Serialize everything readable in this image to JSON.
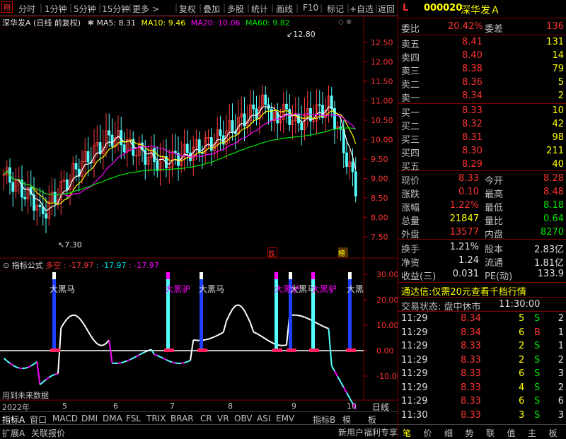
{
  "toolbar": {
    "items": [
      "分时",
      "1分钟",
      "5分钟",
      "15分钟",
      "更多 >",
      "复权",
      "叠加",
      "多股",
      "统计",
      "画线",
      "F10",
      "标记",
      "+自选",
      "返回"
    ]
  },
  "chart_header": {
    "name": "深华发A (日线 前复权)",
    "ma5_label": "MA5: 8.31",
    "ma10_label": "MA10: 9.46",
    "ma20_label": "MA20: 10.06",
    "ma60_label": "MA60: 9.82"
  },
  "price_axis": [
    "12.50",
    "12.00",
    "11.50",
    "11.00",
    "10.50",
    "10.00",
    "9.50",
    "9.00",
    "8.50",
    "8.00",
    "7.50"
  ],
  "annotations": {
    "high": "12.80",
    "low": "7.30",
    "limit_down": "跌",
    "list_tag": "榜"
  },
  "indicator_header": {
    "name": "指标公式",
    "label_kong": "多空",
    "v1": ": -17.97",
    "v2": ": -17.97",
    "v3": ": -17.97"
  },
  "indicator_axis": [
    "30.00",
    "20.00",
    "10.00",
    "0.00",
    "-10.00",
    "-20.00"
  ],
  "signals": [
    "大黑马",
    "大黑驴",
    "大黑马",
    "大黑驴",
    "大黑马",
    "大黑驴",
    "大黑"
  ],
  "future_note": "用到未来数据",
  "date_axis": [
    "2022年",
    "5",
    "6",
    "7",
    "8",
    "9",
    "10"
  ],
  "period_label": "日线",
  "bottom_tabs": [
    "指标A",
    "窗口",
    "MACD",
    "DMI",
    "DMA",
    "FSL",
    "TRIX",
    "BRAR",
    "CR",
    "VR",
    "OBV",
    "ASI",
    "EMV",
    "指标B",
    "模",
    "板"
  ],
  "bottom_row2": [
    "扩展A",
    "关联报价"
  ],
  "right_panel": {
    "header_l": "L",
    "code": "000020",
    "name": "深华发Ａ",
    "weibi": {
      "label": "委比",
      "value": "20.42%",
      "label2": "委差",
      "value2": "136"
    },
    "asks": [
      {
        "label": "卖五",
        "price": "8.41",
        "vol": "131"
      },
      {
        "label": "卖四",
        "price": "8.40",
        "vol": "14"
      },
      {
        "label": "卖三",
        "price": "8.38",
        "vol": "79"
      },
      {
        "label": "卖二",
        "price": "8.36",
        "vol": "5"
      },
      {
        "label": "卖一",
        "price": "8.34",
        "vol": "2"
      }
    ],
    "bids": [
      {
        "label": "买一",
        "price": "8.33",
        "vol": "10"
      },
      {
        "label": "买二",
        "price": "8.32",
        "vol": "42"
      },
      {
        "label": "买三",
        "price": "8.31",
        "vol": "98"
      },
      {
        "label": "买四",
        "price": "8.30",
        "vol": "211"
      },
      {
        "label": "买五",
        "price": "8.29",
        "vol": "40"
      }
    ],
    "stats": [
      {
        "l1": "现价",
        "v1": "8.33",
        "l2": "今开",
        "v2": "8.28"
      },
      {
        "l1": "涨跌",
        "v1": "0.10",
        "l2": "最高",
        "v2": "8.48"
      },
      {
        "l1": "涨幅",
        "v1": "1.22%",
        "l2": "最低",
        "v2": "8.18"
      },
      {
        "l1": "总量",
        "v1": "21847",
        "l2": "量比",
        "v2": "0.64"
      },
      {
        "l1": "外盘",
        "v1": "13577",
        "l2": "内盘",
        "v2": "8270"
      }
    ],
    "stats2": [
      {
        "l1": "换手",
        "v1": "1.21%",
        "l2": "股本",
        "v2": "2.83亿"
      },
      {
        "l1": "净资",
        "v1": "1.24",
        "l2": "流通",
        "v2": "1.81亿"
      },
      {
        "l1": "收益(三)",
        "v1": "0.031",
        "l2": "PE(动)",
        "v2": "133.9"
      }
    ],
    "ad": "通达信:仅需20元查看千档行情",
    "trade_status": "交易状态: 盘中休市",
    "trade_time": "11:30:00",
    "ticks": [
      {
        "t": "11:29",
        "p": "8.34",
        "v": "5",
        "d": "S",
        "n": "2"
      },
      {
        "t": "11:29",
        "p": "8.34",
        "v": "6",
        "d": "B",
        "n": "1"
      },
      {
        "t": "11:29",
        "p": "8.33",
        "v": "2",
        "d": "S",
        "n": "1"
      },
      {
        "t": "11:29",
        "p": "8.33",
        "v": "2",
        "d": "S",
        "n": "2"
      },
      {
        "t": "11:29",
        "p": "8.33",
        "v": "6",
        "d": "S",
        "n": "3"
      },
      {
        "t": "11:29",
        "p": "8.33",
        "v": "4",
        "d": "S",
        "n": "2"
      },
      {
        "t": "11:29",
        "p": "8.33",
        "v": "6",
        "d": "S",
        "n": "6"
      },
      {
        "t": "11:30",
        "p": "8.33",
        "v": "3",
        "d": "S",
        "n": "3"
      }
    ],
    "tabs": [
      "笔",
      "价",
      "细",
      "势",
      "联",
      "值",
      "主",
      "板"
    ],
    "promo": "新用户福利专享"
  }
}
